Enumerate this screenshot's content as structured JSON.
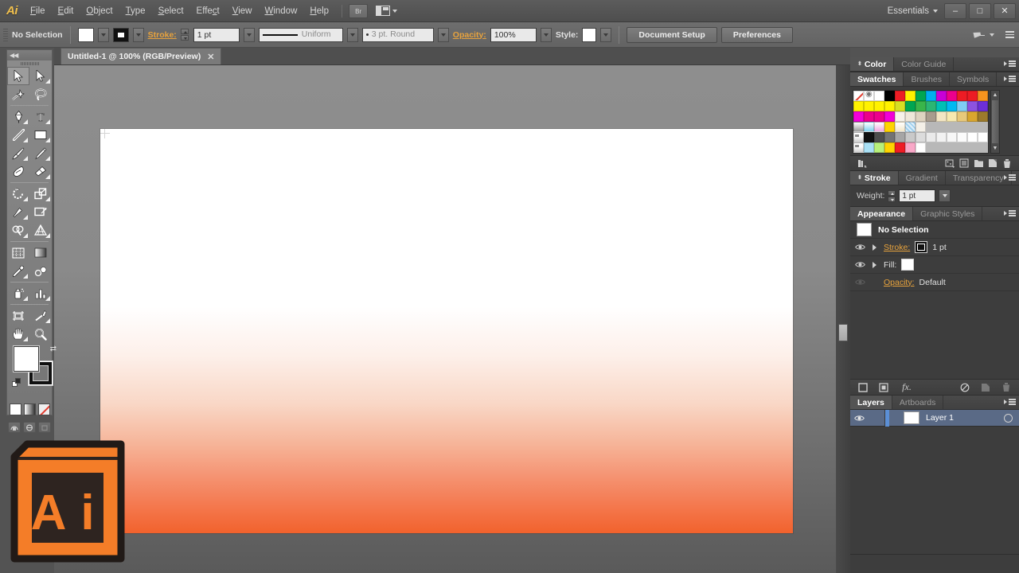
{
  "app": {
    "name": "Adobe Illustrator",
    "logo_text": "Ai",
    "workspace": "Essentials",
    "accent_orange": "#e8a33d",
    "gradient_bottom": "#f2622d",
    "gradient_top": "#ffffff"
  },
  "menubar": {
    "items": [
      {
        "label": "File",
        "mnemonic": "F"
      },
      {
        "label": "Edit",
        "mnemonic": "E"
      },
      {
        "label": "Object",
        "mnemonic": "O"
      },
      {
        "label": "Type",
        "mnemonic": "T"
      },
      {
        "label": "Select",
        "mnemonic": "S"
      },
      {
        "label": "Effect",
        "mnemonic": "c"
      },
      {
        "label": "View",
        "mnemonic": "V"
      },
      {
        "label": "Window",
        "mnemonic": "W"
      },
      {
        "label": "Help",
        "mnemonic": "H"
      }
    ],
    "bridge_button": "Br",
    "arrange_icon": "arrange-documents-icon",
    "window_controls": {
      "minimize": "–",
      "maximize": "□",
      "close": "✕"
    }
  },
  "controlbar": {
    "selection_status": "No Selection",
    "fill_swatch": "#ffffff",
    "stroke_label": "Stroke:",
    "stroke_weight": "1 pt",
    "stroke_profile": "Uniform",
    "brush_definition": "3 pt. Round",
    "opacity_label": "Opacity:",
    "opacity_value": "100%",
    "style_label": "Style:",
    "style_swatch": "#ffffff",
    "document_setup_button": "Document Setup",
    "preferences_button": "Preferences",
    "pin_icon": "pin-icon",
    "panel_menu_icon": "panel-menu-icon"
  },
  "document_tab": {
    "title": "Untitled-1 @ 100% (RGB/Preview)",
    "close_glyph": "✕"
  },
  "toolbar": {
    "collapse_icon": "double-arrow-left-icon",
    "tools": [
      {
        "name": "selection-tool",
        "active": true,
        "corner": false
      },
      {
        "name": "direct-selection-tool",
        "active": false,
        "corner": true
      },
      {
        "name": "magic-wand-tool",
        "active": false,
        "corner": false
      },
      {
        "name": "lasso-tool",
        "active": false,
        "corner": false
      },
      {
        "name": "pen-tool",
        "active": false,
        "corner": true
      },
      {
        "name": "type-tool",
        "active": false,
        "corner": true
      },
      {
        "name": "line-segment-tool",
        "active": false,
        "corner": true
      },
      {
        "name": "rectangle-tool",
        "active": false,
        "corner": true
      },
      {
        "name": "paintbrush-tool",
        "active": false,
        "corner": true
      },
      {
        "name": "pencil-tool",
        "active": false,
        "corner": true
      },
      {
        "name": "blob-brush-tool",
        "active": false,
        "corner": false
      },
      {
        "name": "eraser-tool",
        "active": false,
        "corner": true
      },
      {
        "name": "rotate-tool",
        "active": false,
        "corner": true
      },
      {
        "name": "scale-tool",
        "active": false,
        "corner": true
      },
      {
        "name": "width-tool",
        "active": false,
        "corner": true
      },
      {
        "name": "free-transform-tool",
        "active": false,
        "corner": false
      },
      {
        "name": "shape-builder-tool",
        "active": false,
        "corner": true
      },
      {
        "name": "perspective-grid-tool",
        "active": false,
        "corner": true
      },
      {
        "name": "mesh-tool",
        "active": false,
        "corner": false
      },
      {
        "name": "gradient-tool",
        "active": false,
        "corner": false
      },
      {
        "name": "eyedropper-tool",
        "active": false,
        "corner": true
      },
      {
        "name": "blend-tool",
        "active": false,
        "corner": false
      },
      {
        "name": "symbol-sprayer-tool",
        "active": false,
        "corner": true
      },
      {
        "name": "column-graph-tool",
        "active": false,
        "corner": true
      },
      {
        "name": "artboard-tool",
        "active": false,
        "corner": false
      },
      {
        "name": "slice-tool",
        "active": false,
        "corner": true
      },
      {
        "name": "hand-tool",
        "active": false,
        "corner": true
      },
      {
        "name": "zoom-tool",
        "active": false,
        "corner": false
      }
    ],
    "fill_color": "#ffffff",
    "stroke_color": "#111111",
    "swap_icon": "swap-fill-stroke-icon",
    "default_icon": "default-fill-stroke-icon",
    "color_modes": [
      {
        "name": "color-mode-button",
        "kind": "solid"
      },
      {
        "name": "gradient-mode-button",
        "kind": "gradient"
      },
      {
        "name": "none-mode-button",
        "kind": "none"
      }
    ],
    "screen_modes": [
      {
        "name": "normal-screen-mode-button"
      },
      {
        "name": "fullscreen-menubar-mode-button"
      },
      {
        "name": "fullscreen-mode-button"
      }
    ],
    "change_screen_mode_icon": "change-screen-mode-icon"
  },
  "panels": {
    "color_group": {
      "tabs": [
        {
          "label": "Color",
          "active": true
        },
        {
          "label": "Color Guide",
          "active": false
        }
      ]
    },
    "swatches_group": {
      "tabs": [
        {
          "label": "Swatches",
          "active": true
        },
        {
          "label": "Brushes",
          "active": false
        },
        {
          "label": "Symbols",
          "active": false
        }
      ],
      "swatch_rows": [
        [
          "none",
          "registration",
          "#ffffff",
          "#000000",
          "#ed1c24",
          "#fff200",
          "#00a651",
          "#00aeef",
          "#c800d8",
          "#ec008c",
          "#ed1c24",
          "#ed1c24",
          "#f7941e"
        ],
        [
          "#fff200",
          "#fff200",
          "#fff200",
          "#fff200",
          "#d7df23",
          "#00a651",
          "#39b54a",
          "#2bb673",
          "#00c0b5",
          "#00b9f2",
          "#7fcdf4",
          "#8c52e0",
          "#6c2fd6"
        ],
        [
          "#f200d8",
          "#ec008c",
          "#ec008c",
          "#f200d8",
          "#f7f2ea",
          "#efe7d9",
          "#ded3c0",
          "#a89c8d",
          "#f3e6c4",
          "#f7e9b0",
          "#e8c97a",
          "#d9a62e",
          "#9c7a2b"
        ],
        [
          "gradient-white-gray",
          "gradient-blue",
          "gradient-pink",
          "#ffd400",
          "gradient-cream",
          "pattern-blue",
          "#f4f0e8",
          "empty",
          "empty",
          "empty",
          "empty",
          "empty",
          "empty"
        ],
        [
          "folder",
          "#111111",
          "#4d4d4d",
          "#737373",
          "#a6a6a6",
          "#c9c9c9",
          "#dcdcdc",
          "#eaeaea",
          "#f2f2f2",
          "#f7f7f7",
          "#fbfbfb",
          "#ffffff",
          "#ffffff"
        ],
        [
          "folder",
          "#a9e0f5",
          "#b8f07a",
          "#ffd400",
          "#ee1c25",
          "#f9a8c8",
          "#ffffff",
          "empty",
          "empty",
          "empty",
          "empty",
          "empty",
          "empty"
        ]
      ],
      "footer_icons": [
        "swatch-libraries-icon",
        "show-swatch-kinds-icon",
        "swatch-options-icon",
        "new-color-group-icon",
        "new-swatch-icon",
        "delete-swatch-icon"
      ]
    },
    "stroke_group": {
      "tabs": [
        {
          "label": "Stroke",
          "active": true
        },
        {
          "label": "Gradient",
          "active": false
        },
        {
          "label": "Transparency",
          "active": false
        }
      ],
      "weight_label": "Weight:",
      "weight_value": "1 pt"
    },
    "appearance_group": {
      "tabs": [
        {
          "label": "Appearance",
          "active": true
        },
        {
          "label": "Graphic Styles",
          "active": false
        }
      ],
      "target_title": "No Selection",
      "rows": [
        {
          "name": "Stroke:",
          "value": "1 pt",
          "swatch": "#111111",
          "is_link": true,
          "visible": true
        },
        {
          "name": "Fill:",
          "value": "",
          "swatch": "#ffffff",
          "is_link": false,
          "visible": true
        },
        {
          "name": "Opacity:",
          "value": "Default",
          "swatch": null,
          "is_link": true,
          "visible": false
        }
      ],
      "footer_icons": [
        "add-new-stroke-icon",
        "add-new-fill-icon",
        "add-new-effect-icon",
        "clear-appearance-icon",
        "duplicate-item-icon",
        "delete-item-icon"
      ],
      "fx_label": "fx."
    },
    "layers_group": {
      "tabs": [
        {
          "label": "Layers",
          "active": true
        },
        {
          "label": "Artboards",
          "active": false
        }
      ],
      "layers": [
        {
          "name": "Layer 1",
          "color": "#5b8fd6",
          "visible": true,
          "locked": false,
          "selected": true
        }
      ]
    }
  },
  "canvas": {
    "artboard_name": "artboard-1",
    "zoom": "100%",
    "color_mode": "RGB",
    "view_mode": "Preview"
  }
}
